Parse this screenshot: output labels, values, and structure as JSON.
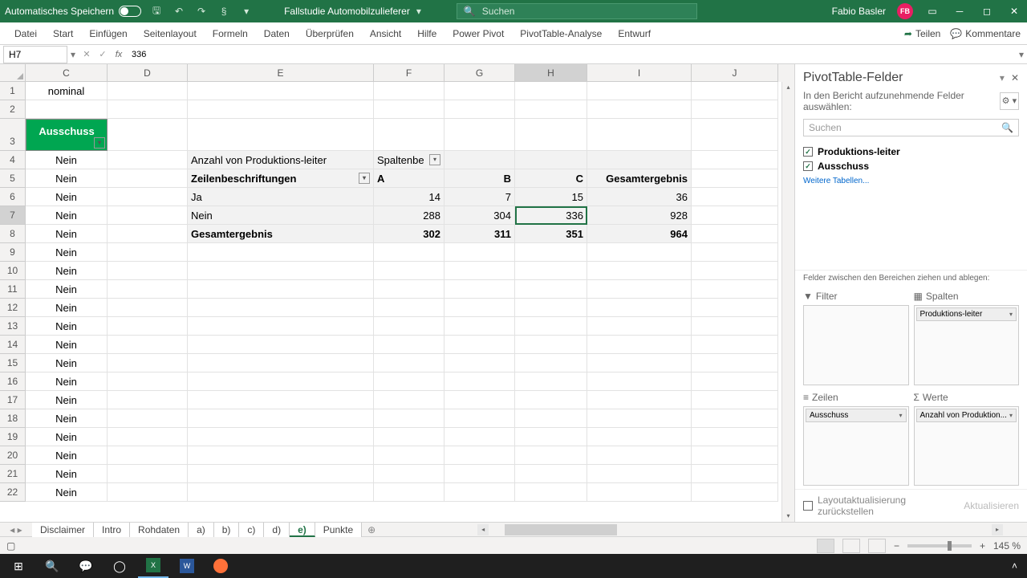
{
  "titlebar": {
    "autosave": "Automatisches Speichern",
    "filename": "Fallstudie Automobilzulieferer",
    "search_placeholder": "Suchen",
    "user": "Fabio Basler",
    "initials": "FB"
  },
  "ribbon": {
    "tabs": [
      "Datei",
      "Start",
      "Einfügen",
      "Seitenlayout",
      "Formeln",
      "Daten",
      "Überprüfen",
      "Ansicht",
      "Hilfe",
      "Power Pivot",
      "PivotTable-Analyse",
      "Entwurf"
    ],
    "share": "Teilen",
    "comments": "Kommentare"
  },
  "formula": {
    "cellref": "H7",
    "value": "336"
  },
  "columns": [
    "C",
    "D",
    "E",
    "F",
    "G",
    "H",
    "I",
    "J"
  ],
  "rows": [
    "1",
    "2",
    "3",
    "4",
    "5",
    "6",
    "7",
    "8",
    "9",
    "10",
    "11",
    "12",
    "13",
    "14",
    "15",
    "16",
    "17",
    "18",
    "19",
    "20",
    "21",
    "22"
  ],
  "colC": {
    "r1": "nominal",
    "header": "Ausschuss",
    "vals": [
      "Nein",
      "Nein",
      "Nein",
      "Nein",
      "Nein",
      "Nein",
      "Nein",
      "Nein",
      "Nein",
      "Nein",
      "Nein",
      "Nein",
      "Nein",
      "Nein",
      "Nein",
      "Nein",
      "Nein",
      "Nein",
      "Nein"
    ]
  },
  "pivot": {
    "cornerLabel": "Anzahl von Produktions-leiter",
    "colLabel": "Spaltenbe",
    "rowLabel": "Zeilenbeschriftungen",
    "cols": [
      "A",
      "B",
      "C"
    ],
    "totalLabel": "Gesamtergebnis",
    "rows": [
      {
        "label": "Ja",
        "vals": [
          "14",
          "7",
          "15"
        ],
        "total": "36"
      },
      {
        "label": "Nein",
        "vals": [
          "288",
          "304",
          "336"
        ],
        "total": "928"
      }
    ],
    "grand": {
      "label": "Gesamtergebnis",
      "vals": [
        "302",
        "311",
        "351"
      ],
      "total": "964"
    }
  },
  "panel": {
    "title": "PivotTable-Felder",
    "sub": "In den Bericht aufzunehmende Felder auswählen:",
    "search": "Suchen",
    "fields": [
      {
        "name": "Produktions-leiter",
        "checked": true
      },
      {
        "name": "Ausschuss",
        "checked": true
      }
    ],
    "more": "Weitere Tabellen...",
    "areasLabel": "Felder zwischen den Bereichen ziehen und ablegen:",
    "areas": {
      "filter": {
        "label": "Filter",
        "items": []
      },
      "cols": {
        "label": "Spalten",
        "items": [
          "Produktions-leiter"
        ]
      },
      "rows": {
        "label": "Zeilen",
        "items": [
          "Ausschuss"
        ]
      },
      "vals": {
        "label": "Werte",
        "items": [
          "Anzahl von Produktion..."
        ]
      }
    },
    "defer": "Layoutaktualisierung zurückstellen",
    "update": "Aktualisieren"
  },
  "sheets": [
    "Disclaimer",
    "Intro",
    "Rohdaten",
    "a)",
    "b)",
    "c)",
    "d)",
    "e)",
    "Punkte"
  ],
  "activeSheet": "e)",
  "status": {
    "zoom": "145 %"
  }
}
